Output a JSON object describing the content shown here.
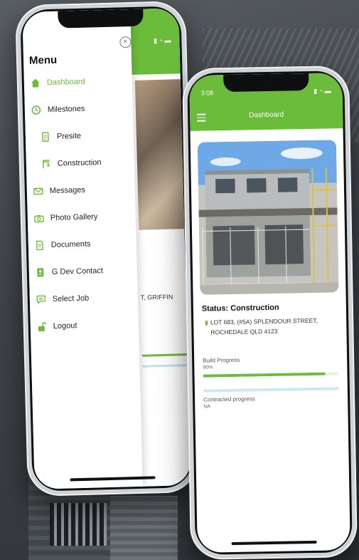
{
  "left_phone": {
    "menu_title": "Menu",
    "close_icon": "close-circle-icon",
    "menu_items": [
      {
        "label": "Dashboard",
        "icon": "home-icon",
        "active": true
      },
      {
        "label": "Milestones",
        "icon": "clock-icon",
        "active": false
      },
      {
        "label": "Presite",
        "icon": "document-icon",
        "active": false
      },
      {
        "label": "Construction",
        "icon": "crane-icon",
        "active": false
      },
      {
        "label": "Messages",
        "icon": "mail-icon",
        "active": false
      },
      {
        "label": "Photo Gallery",
        "icon": "camera-icon",
        "active": false
      },
      {
        "label": "Documents",
        "icon": "file-icon",
        "active": false
      },
      {
        "label": "G Dev Contact",
        "icon": "contact-book-icon",
        "active": false
      },
      {
        "label": "Select Job",
        "icon": "chat-icon",
        "active": false
      },
      {
        "label": "Logout",
        "icon": "lock-icon",
        "active": false
      }
    ],
    "background_address_fragment": "T, GRIFFIN"
  },
  "right_phone": {
    "status_time": "3:08",
    "header_title": "Dashboard",
    "status": "Status: Construction",
    "address_line1": "LOT 683, (#5A) SPLENDOUR STREET,",
    "address_line2": "ROCHEDALE QLD 4123",
    "build_progress_label": "Build Progress",
    "build_progress_value": "90%",
    "build_progress_fraction": 0.9,
    "contracted_progress_label": "Contracted progress",
    "contracted_progress_value": "NA"
  },
  "colors": {
    "accent": "#6cbc3c",
    "light_blue": "#cfe9f4"
  }
}
